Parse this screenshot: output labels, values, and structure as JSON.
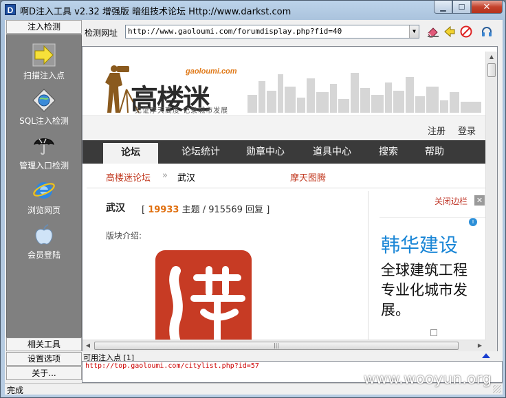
{
  "window": {
    "title": "啊D注入工具 v2.32 增强版 暗组技术论坛 Http://www.darkst.com",
    "app_icon_letter": "D"
  },
  "sidebar": {
    "header": "注入检测",
    "items": [
      {
        "label": "扫描注入点",
        "icon": "arrow-right-icon"
      },
      {
        "label": "SQL注入检测",
        "icon": "globe-icon"
      },
      {
        "label": "管理入口检测",
        "icon": "umbrella-icon"
      },
      {
        "label": "浏览网页",
        "icon": "ie-browser-icon"
      },
      {
        "label": "会员登陆",
        "icon": "apple-icon"
      }
    ],
    "buttons": [
      "相关工具",
      "设置选项",
      "关于..."
    ]
  },
  "toolbar": {
    "url_label": "检测网址",
    "url_value": "http://www.gaoloumi.com/forumdisplay.php?fid=40"
  },
  "webpage": {
    "logo_text": "高楼迷",
    "logo_domain": "gaoloumi.com",
    "logo_slogan": "见证摩天高度 记录城市发展",
    "top_links": [
      "注册",
      "登录"
    ],
    "nav": [
      "论坛",
      "论坛统计",
      "勋章中心",
      "道具中心",
      "搜索",
      "帮助"
    ],
    "breadcrumb": {
      "home": "高楼迷论坛",
      "sep": "»",
      "current": "武汉",
      "extra": "摩天图腾"
    },
    "forum": {
      "name": "武汉",
      "topics": "19933",
      "topics_label": "主题",
      "posts": "915569",
      "posts_label": "回复",
      "description_label": "版块介绍:"
    },
    "ad": {
      "close_label": "关闭边栏",
      "title": "韩华建设",
      "body": "全球建筑工程 专业化城市发展。"
    }
  },
  "results": {
    "label": "可用注入点 [1]",
    "items": [
      "http://top.gaoloumi.com/citylist.php?id=57"
    ]
  },
  "status": {
    "text": "完成"
  },
  "watermark": "www.wooyun.org"
}
